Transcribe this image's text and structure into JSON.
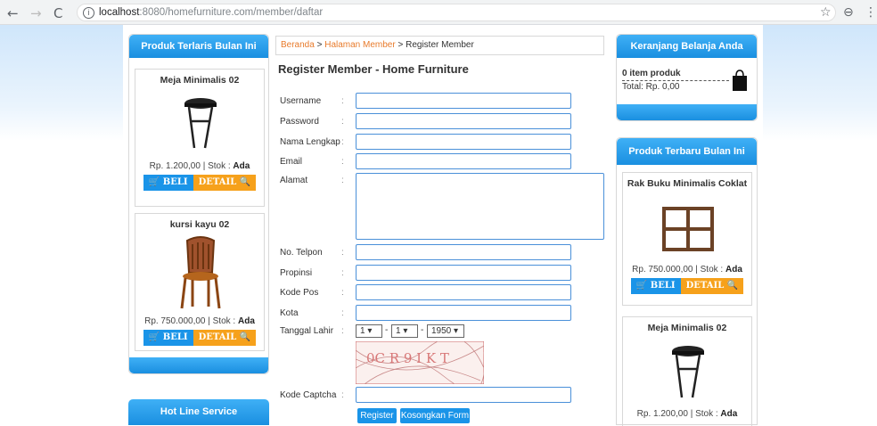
{
  "browser": {
    "url_host": "localhost",
    "url_rest": ":8080/homefurniture.com/member/daftar",
    "back": "←",
    "forward": "→",
    "reload": "C",
    "star": "☆",
    "profile": "⊖",
    "menu": "⋮",
    "info": "i"
  },
  "left": {
    "terlaris_title": "Produk Terlaris Bulan Ini",
    "products": [
      {
        "name": "Meja Minimalis 02",
        "price": "Rp. 1.200,00 | Stok : ",
        "stock": "Ada",
        "beli": "BELI",
        "detail": "DETAIL"
      },
      {
        "name": "kursi kayu 02",
        "price": "Rp. 750.000,00 | Stok : ",
        "stock": "Ada",
        "beli": "BELI",
        "detail": "DETAIL"
      }
    ],
    "hotline_title": "Hot Line Service"
  },
  "breadcrumb": {
    "home": "Beranda",
    "member": "Halaman Member",
    "current": "Register Member",
    "sep": " > "
  },
  "form": {
    "title": "Register Member - Home Furniture",
    "colon": ":",
    "labels": {
      "username": "Username",
      "password": "Password",
      "nama": "Nama Lengkap",
      "email": "Email",
      "alamat": "Alamat",
      "telpon": "No. Telpon",
      "propinsi": "Propinsi",
      "kodepos": "Kode Pos",
      "kota": "Kota",
      "tgl": "Tanggal Lahir",
      "captcha": "Kode Captcha"
    },
    "day": "1",
    "month": "1",
    "year": "1950",
    "dash": "-",
    "captcha_text": "0C R 9 I K T",
    "register": "Register",
    "reset": "Kosongkan Form"
  },
  "right": {
    "cart_title": "Keranjang Belanja Anda",
    "cart_items": "0 item produk",
    "cart_total": "Total: Rp. 0,00",
    "terbaru_title": "Produk Terbaru Bulan Ini",
    "products": [
      {
        "name": "Rak Buku Minimalis Coklat",
        "price": "Rp. 750.000,00 | Stok : ",
        "stock": "Ada",
        "beli": "BELI",
        "detail": "DETAIL"
      },
      {
        "name": "Meja Minimalis 02",
        "price": "Rp. 1.200,00 | Stok : ",
        "stock": "Ada"
      }
    ]
  },
  "colors": {
    "accent": "#1a94e8",
    "orange": "#f6a11b",
    "link": "#e87b2c"
  }
}
